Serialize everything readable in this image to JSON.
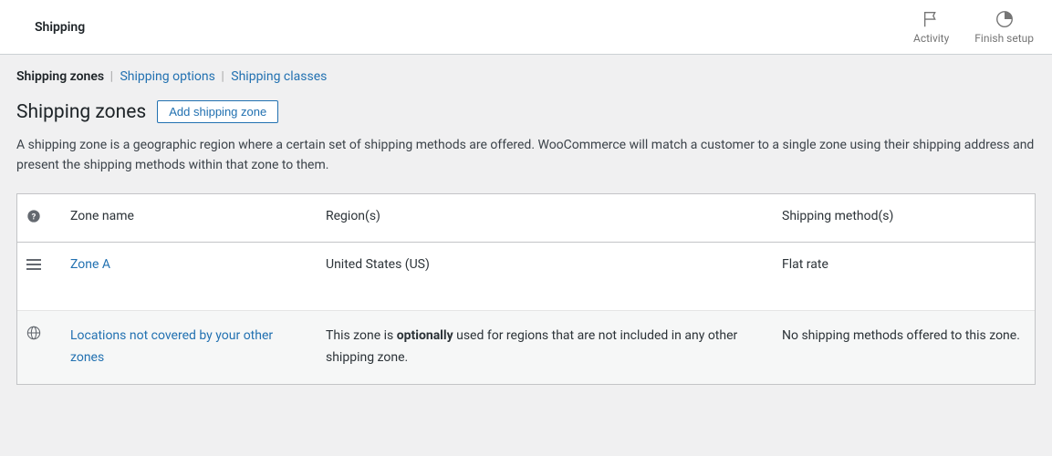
{
  "topbar": {
    "title": "Shipping",
    "actions": {
      "activity": "Activity",
      "finish_setup": "Finish setup"
    }
  },
  "subtabs": {
    "zones": "Shipping zones",
    "options": "Shipping options",
    "classes": "Shipping classes"
  },
  "heading": "Shipping zones",
  "add_button": "Add shipping zone",
  "description": "A shipping zone is a geographic region where a certain set of shipping methods are offered. WooCommerce will match a customer to a single zone using their shipping address and present the shipping methods within that zone to them.",
  "table": {
    "columns": {
      "name": "Zone name",
      "region": "Region(s)",
      "methods": "Shipping method(s)"
    },
    "rows": [
      {
        "name": "Zone A",
        "region": "United States (US)",
        "methods": "Flat rate"
      }
    ],
    "default": {
      "name": "Locations not covered by your other zones",
      "region_pre": "This zone is ",
      "region_bold": "optionally",
      "region_post": " used for regions that are not included in any other shipping zone.",
      "methods": "No shipping methods offered to this zone."
    }
  }
}
